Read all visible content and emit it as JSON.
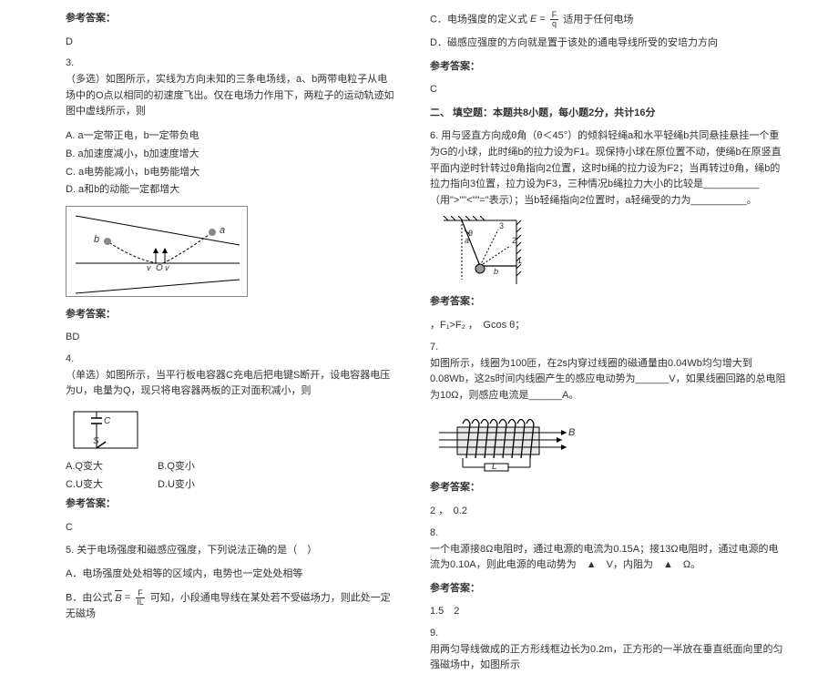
{
  "left": {
    "ans_label": "参考答案：",
    "ans2": "D",
    "q3_num": "3.",
    "q3_text": "（多选）如图所示，实线为方向未知的三条电场线，a、b两带电粒子从电场中的O点以相同的初速度飞出。仅在电场力作用下，两粒子的运动轨迹如图中虚线所示，则",
    "q3_optA": "A. a一定带正电，b一定带负电",
    "q3_optB": "B. a加速度减小，b加速度增大",
    "q3_optC": "C. a电势能减小，b电势能增大",
    "q3_optD": "D. a和b的动能一定都增大",
    "fig1_label_a": "a",
    "fig1_label_b": "b",
    "fig1_label_v1": "v",
    "fig1_label_v2": "v",
    "fig1_label_O": "O",
    "ans3": "BD",
    "q4_num": "4.",
    "q4_text": "（单选）如图所示，当平行板电容器C充电后把电键S断开，设电容器电压为U，电量为Q，现只将电容器两板的正对面积减小，则",
    "fig2_label_C": "C",
    "fig2_label_S": "S",
    "q4_optA": "A.Q变大",
    "q4_optB": "B.Q变小",
    "q4_optC": "C.U变大",
    "q4_optD": "D.U变小",
    "ans4": "C",
    "q5_num": "5.",
    "q5_text": "关于电场强度和磁感应强度，下列说法正确的是（　）",
    "q5_optA": "A．电场强度处处相等的区域内，电势也一定处处相等",
    "q5_optB_pre": "B．由公式",
    "q5_optB_formula_B": "B",
    "q5_optB_formula_F": "F",
    "q5_optB_formula_IL": "IL",
    "q5_optB_post": "可知，小段通电导线在某处若不受磁场力，则此处一定无磁场"
  },
  "right": {
    "q5_optC_pre": "C．电场强度的定义式",
    "q5_optC_formula_E": "E",
    "q5_optC_formula_F": "F",
    "q5_optC_formula_q": "q",
    "q5_optC_post": "适用于任何电场",
    "q5_optD": "D．磁感应强度的方向就是置于该处的通电导线所受的安培力方向",
    "ans_label": "参考答案：",
    "ans5": "C",
    "section2": "二、 填空题：本题共8小题，每小题2分，共计16分",
    "q6_num": "6.",
    "q6_text": "用与竖直方向成θ角（θ＜45°）的倾斜轻绳a和水平轻绳b共同悬挂悬挂一个重为G的小球，此时绳b的拉力设为F1。现保持小球在原位置不动，使绳b在原竖直平面内逆时针转过θ角指向2位置，这时b绳的拉力设为F2；当再转过θ角，绳b的拉力指向3位置，拉力设为F3，三种情况b绳拉力大小的比较是__________（用\">\"\"<\"\"=\"表示）；当b轻绳指向2位置时，a轻绳受的力为__________。",
    "fig3_label_a": "a",
    "fig3_label_b": "b",
    "fig3_label_1": "1",
    "fig3_label_2": "2",
    "fig3_label_3": "3",
    "fig3_label_theta1": "θ",
    "fig3_label_theta2": "θ",
    "ans6": "，F₁>F₂ ，　Gcos θ；",
    "q7_num": "7.",
    "q7_text": "如图所示，线圈为100匝，在2s内穿过线圈的磁通量由0.04Wb均匀增大到0.08Wb，这2s时间内线圈产生的感应电动势为______V，如果线圈回路的总电阻为10Ω，则感应电流是______A。",
    "fig4_label_B": "B",
    "fig4_label_L": "L",
    "ans7": "2 ，　0.2",
    "q8_num": "8.",
    "q8_text": "一个电源接8Ω电阻时，通过电源的电流为0.15A；接13Ω电阻时，通过电源的电流为0.10A，则此电源的电动势为　▲　V，内阻为　▲　Ω。",
    "ans8": "1.5　2",
    "q9_num": "9.",
    "q9_text": "用两匀导线做成的正方形线框边长为0.2m，正方形的一半放在垂直纸面向里的匀强磁场中，如图所示"
  }
}
